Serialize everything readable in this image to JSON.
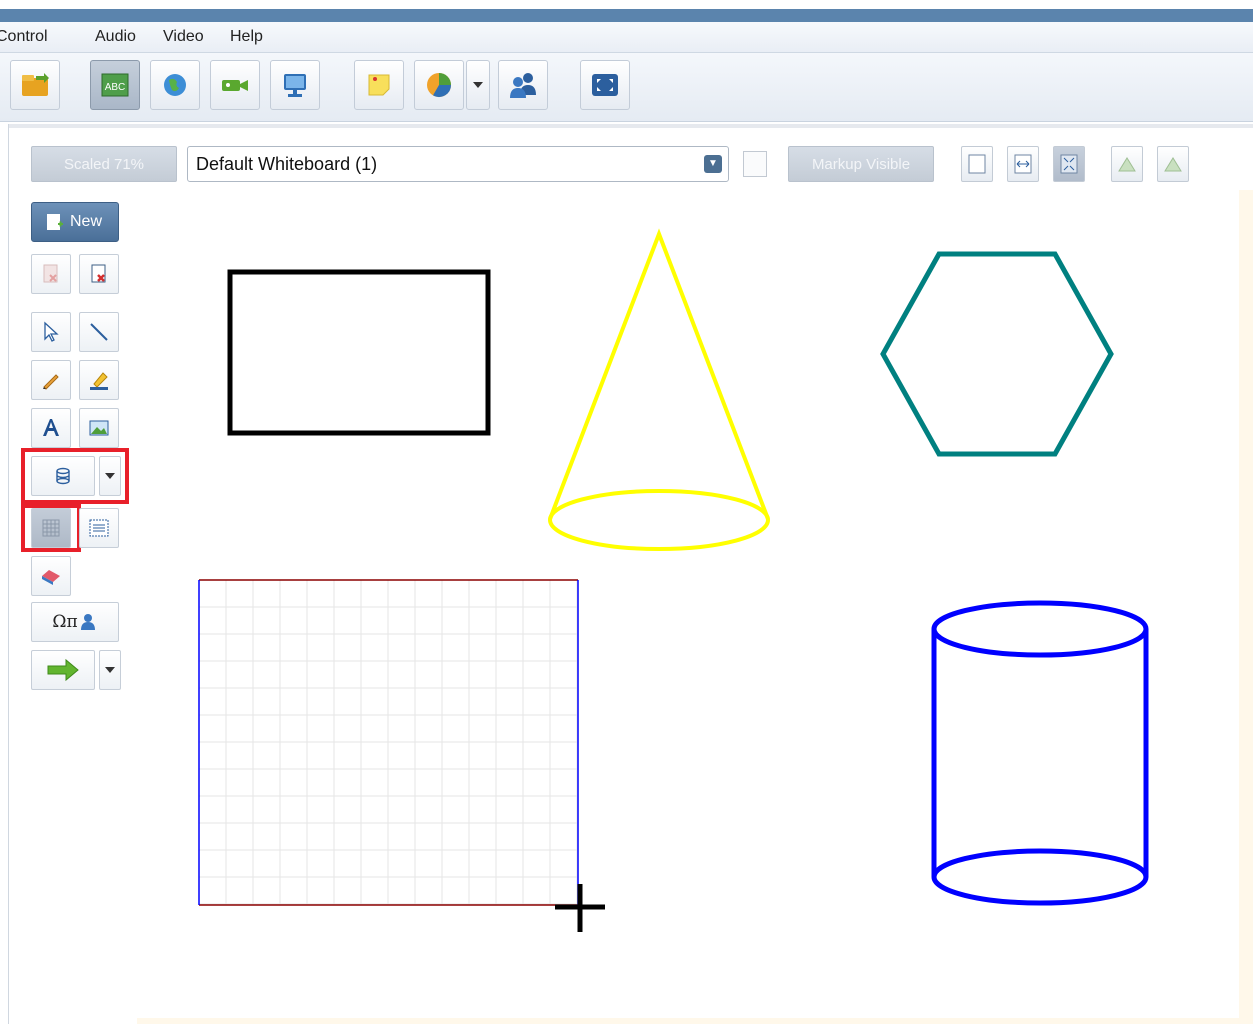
{
  "menu": {
    "items": [
      "Control",
      "Audio",
      "Video",
      "Help"
    ]
  },
  "toolbar": {
    "buttons": [
      "folder-icon",
      "whiteboard-icon",
      "web-browser-icon",
      "video-camera-icon",
      "screen-share-icon",
      "notes-icon",
      "poll-chart-icon",
      "dropdown-arrow",
      "participants-icon",
      "fullscreen-icon"
    ],
    "active": "whiteboard-icon",
    "whiteboard_icon_label": "ABC"
  },
  "options_bar": {
    "scale_label": "Scaled 71%",
    "whiteboard_select": "Default Whiteboard (1)",
    "markup_checkbox_checked": false,
    "markup_label": "Markup Visible"
  },
  "left_tools": {
    "new_label": "New",
    "symbols_label": "Ωπ"
  },
  "canvas": {
    "shapes": [
      "rectangle",
      "cone",
      "hexagon",
      "grid",
      "cylinder"
    ],
    "colors": {
      "rectangle": "#000000",
      "cone": "#ffff00",
      "hexagon": "#008080",
      "cylinder": "#0000ff",
      "grid_border": "#0000ff",
      "grid_edge": "#8b0000"
    }
  }
}
